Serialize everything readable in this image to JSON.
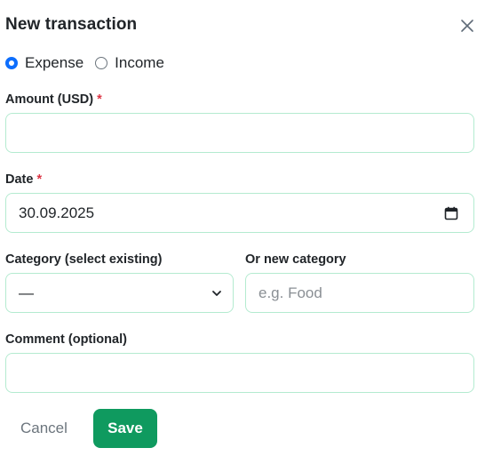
{
  "dialog": {
    "title": "New transaction"
  },
  "type_toggle": {
    "options": [
      {
        "label": "Expense",
        "checked": true
      },
      {
        "label": "Income",
        "checked": false
      }
    ]
  },
  "form": {
    "amount": {
      "label": "Amount (USD)",
      "required_mark": "*",
      "value": ""
    },
    "date": {
      "label": "Date",
      "required_mark": "*",
      "value": "30.09.2025"
    },
    "category": {
      "label": "Category (select existing)",
      "value": "—"
    },
    "new_category": {
      "label": "Or new category",
      "placeholder": "e.g. Food",
      "value": ""
    },
    "comment": {
      "label": "Comment (optional)",
      "value": ""
    }
  },
  "actions": {
    "cancel_label": "Cancel",
    "save_label": "Save"
  },
  "colors": {
    "primary": "#0f9a5f",
    "radio_accent": "#0d6efd",
    "required": "#dc3545",
    "input_border": "#b4ebd0"
  },
  "icons": {
    "close": "close-icon",
    "calendar": "calendar-icon",
    "select": "chevron-down-icon"
  }
}
